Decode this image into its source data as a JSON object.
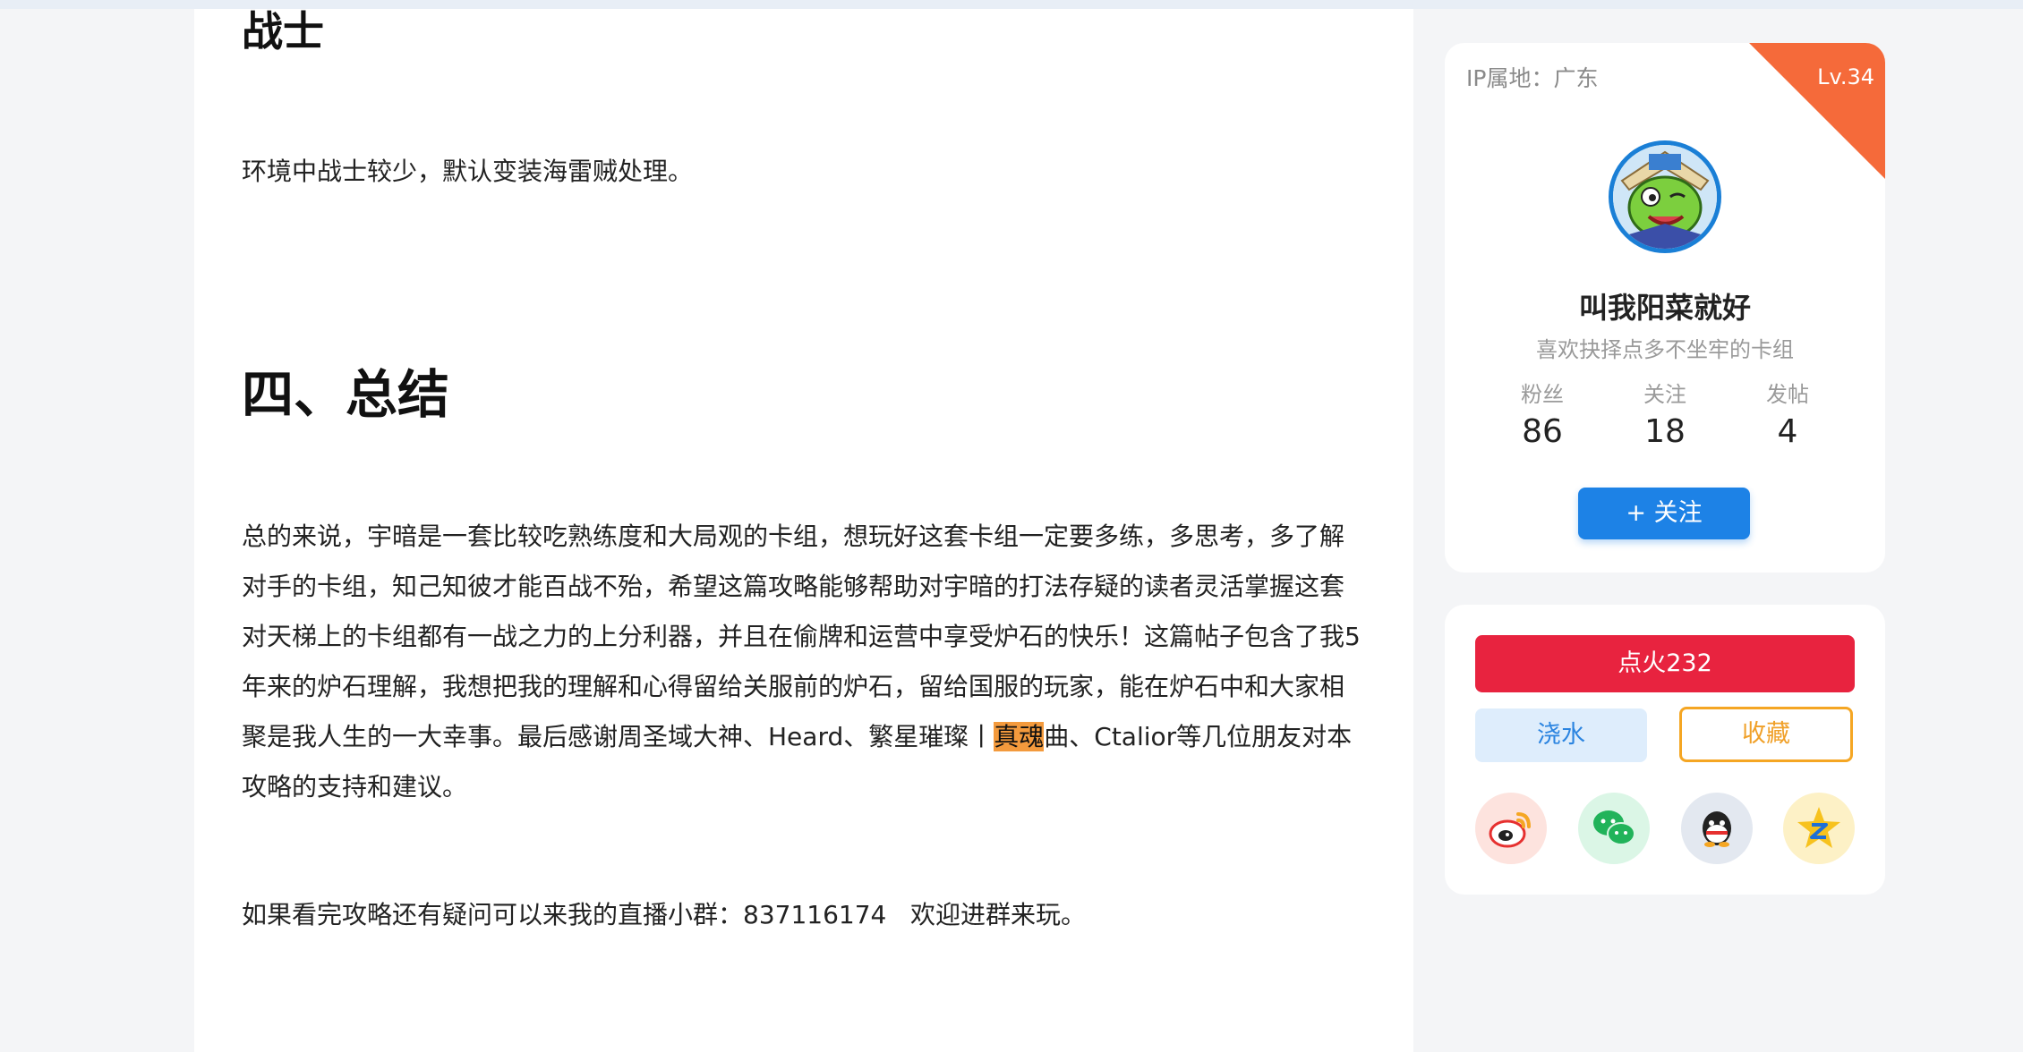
{
  "article": {
    "heading_warrior": "战士",
    "warrior_text": "环境中战士较少，默认变装海雷贼处理。",
    "section_heading": "四、总结",
    "summary": {
      "line1": "总的来说，宇暗是一套比较吃熟练度和大局观的卡组，想玩好这套卡组一定要多练，多思考，多了解",
      "line2": "对手的卡组，知己知彼才能百战不殆，希望这篇攻略能够帮助对宇暗的打法存疑的读者灵活掌握这套",
      "line3": "对天梯上的卡组都有一战之力的上分利器，并且在偷牌和运营中享受炉石的快乐！这篇帖子包含了我5",
      "line4": "年来的炉石理解，我想把我的理解和心得留给关服前的炉石，留给国服的玩家，能在炉石中和大家相",
      "line5_before": "聚是我人生的一大幸事。最后感谢周圣域大神、Heard、繁星璀璨丨",
      "line5_highlight": "真魂",
      "line5_after": "曲、Ctalior等几位朋友对本",
      "line6": "攻略的支持和建议。"
    },
    "group_text": "如果看完攻略还有疑问可以来我的直播小群：837116174   欢迎进群来玩。"
  },
  "profile": {
    "ip_location": "IP属地：广东",
    "level": "Lv.34",
    "username": "叫我阳菜就好",
    "bio": "喜欢抉择点多不坐牢的卡组",
    "stats": [
      {
        "label": "粉丝",
        "value": "86"
      },
      {
        "label": "关注",
        "value": "18"
      },
      {
        "label": "发帖",
        "value": "4"
      }
    ],
    "follow_label": "+ 关注"
  },
  "actions": {
    "ignite_label": "点火232",
    "water_label": "浇水",
    "favorite_label": "收藏",
    "share_icons": [
      "weibo-icon",
      "wechat-icon",
      "qq-icon",
      "qzone-icon"
    ]
  },
  "colors": {
    "accent_blue": "#1d82e6",
    "ignite_red": "#e8233f",
    "favorite_orange": "#f5a623",
    "level_ribbon": "#f56a3a",
    "highlight": "#f39a3d"
  }
}
